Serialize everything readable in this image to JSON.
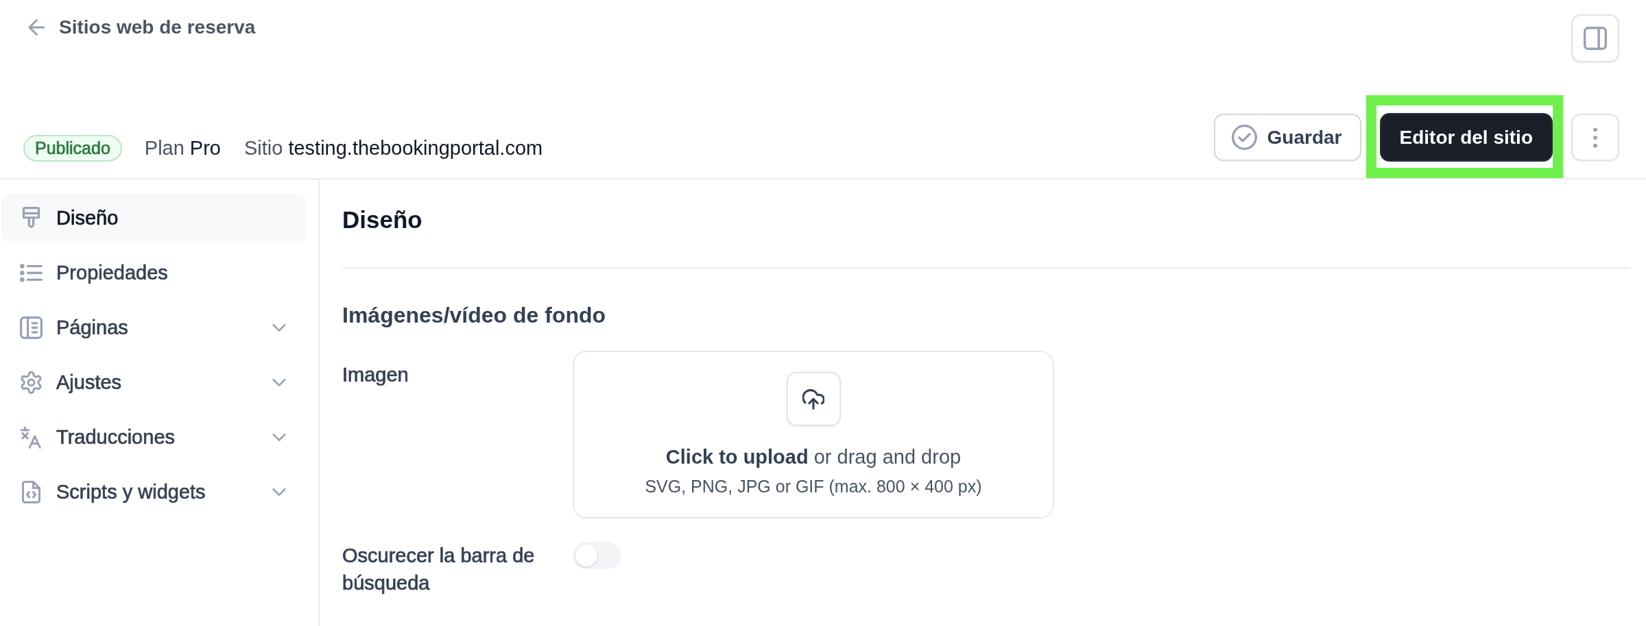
{
  "header": {
    "back_link": "Sitios web de reserva"
  },
  "site_info": {
    "status": "Publicado",
    "plan_label": "Plan",
    "plan": "Pro",
    "site_label": "Sitio",
    "site": "testing.thebookingportal.com"
  },
  "actions": [
    {
      "kind": "save",
      "label": "Guardar",
      "highlighted": false
    },
    {
      "kind": "primary",
      "label": "Editor del sitio",
      "highlighted": true
    },
    {
      "kind": "menu",
      "highlighted": false
    }
  ],
  "sidebar": {
    "items": [
      {
        "label": "Diseño",
        "kind": "link",
        "selected": true
      },
      {
        "label": "Propiedades",
        "kind": "link",
        "selected": false
      },
      {
        "label": "Páginas",
        "kind": "group",
        "selected": false
      },
      {
        "label": "Ajustes",
        "kind": "group",
        "selected": false
      },
      {
        "label": "Traducciones",
        "kind": "group",
        "selected": false
      },
      {
        "label": "Scripts y widgets",
        "kind": "group",
        "selected": false
      }
    ]
  },
  "content": {
    "title": "Diseño",
    "section": "Imágenes/vídeo de fondo",
    "fields": [
      {
        "kind": "upload",
        "label": "Imagen",
        "prompt": "**Click to upload** or drag and drop",
        "hint": "SVG, PNG, JPG or GIF (max. 800 × 400 px)"
      },
      {
        "kind": "toggle",
        "label": "Oscurecer la barra de búsqueda",
        "on": false
      }
    ]
  }
}
